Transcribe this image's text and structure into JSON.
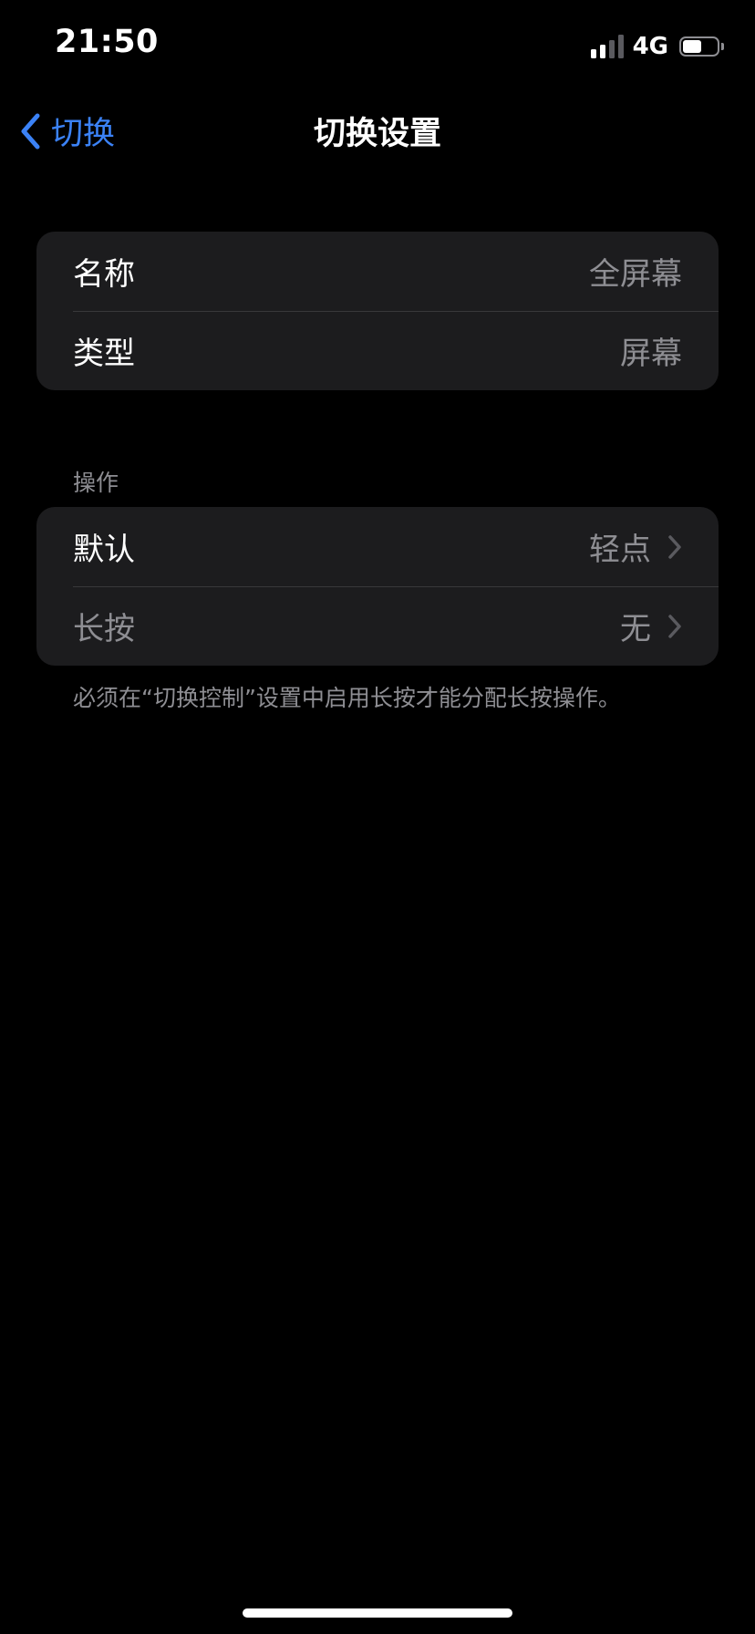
{
  "status_bar": {
    "time": "21:50",
    "network": "4G",
    "signal_bars_active": 2,
    "signal_bars_total": 4,
    "battery_level": 0.55
  },
  "nav": {
    "back_label": "切换",
    "title": "切换设置"
  },
  "info_group": {
    "rows": [
      {
        "label": "名称",
        "value": "全屏幕"
      },
      {
        "label": "类型",
        "value": "屏幕"
      }
    ]
  },
  "actions_group": {
    "header": "操作",
    "rows": [
      {
        "label": "默认",
        "value": "轻点"
      },
      {
        "label": "长按",
        "value": "无"
      }
    ],
    "footer": "必须在“切换控制”设置中启用长按才能分配长按操作。"
  },
  "colors": {
    "accent": "#3b82f6",
    "background": "#000000",
    "group_background": "#1c1c1e",
    "secondary_text": "#8e8e93",
    "separator": "#38383a"
  },
  "icons": {
    "back": "chevron-left-icon",
    "row_disclosure": "chevron-right-icon",
    "signal": "cellular-signal-icon",
    "battery": "battery-icon"
  }
}
